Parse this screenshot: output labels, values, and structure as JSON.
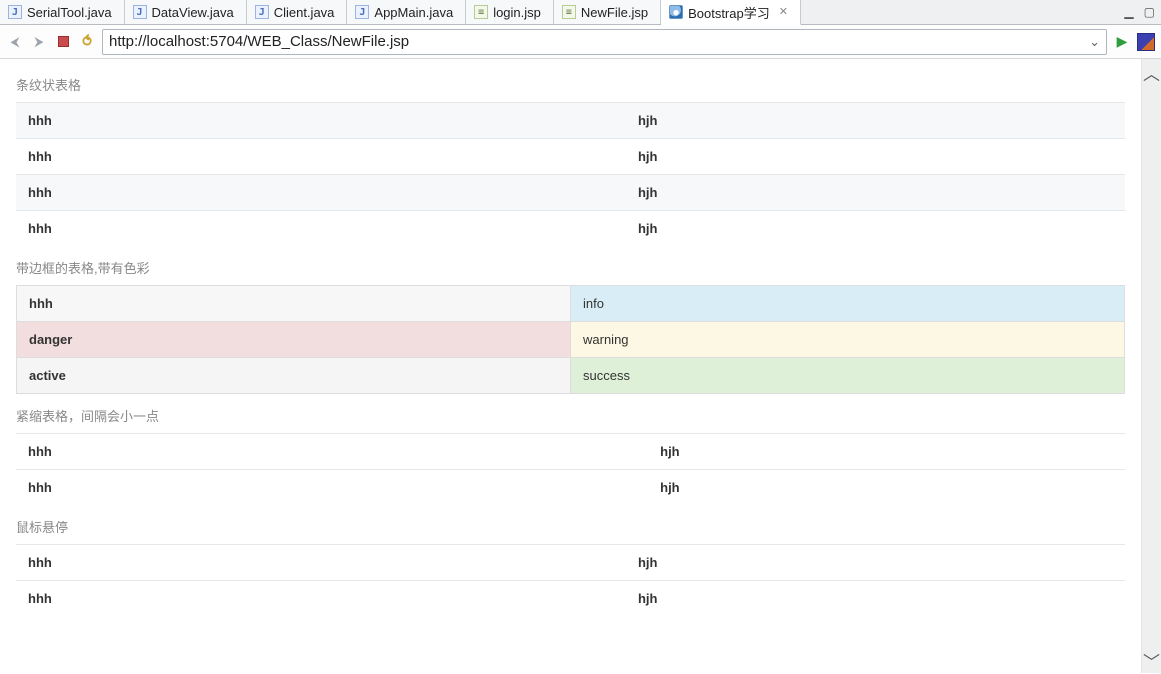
{
  "tabs": [
    {
      "label": "SerialTool.java",
      "icon": "j"
    },
    {
      "label": "DataView.java",
      "icon": "j"
    },
    {
      "label": "Client.java",
      "icon": "j"
    },
    {
      "label": "AppMain.java",
      "icon": "j"
    },
    {
      "label": "login.jsp",
      "icon": "jsp"
    },
    {
      "label": "NewFile.jsp",
      "icon": "jsp"
    },
    {
      "label": "Bootstrap学习",
      "icon": "web",
      "active": true,
      "closable": true
    }
  ],
  "url": "http://localhost:5704/WEB_Class/NewFile.jsp",
  "sections": {
    "striped": {
      "title": "条纹状表格",
      "rows": [
        {
          "c1": "hhh",
          "c2": "hjh"
        },
        {
          "c1": "hhh",
          "c2": "hjh"
        },
        {
          "c1": "hhh",
          "c2": "hjh"
        },
        {
          "c1": "hhh",
          "c2": "hjh"
        }
      ]
    },
    "bordered": {
      "title": "带边框的表格,带有色彩",
      "rows": [
        {
          "c1": "hhh",
          "c1_class": "cell-bold",
          "c2": "info",
          "c2_class": "cell-info"
        },
        {
          "c1": "danger",
          "c1_class": "cell-danger",
          "c2": "warning",
          "c2_class": "cell-warning"
        },
        {
          "c1": "active",
          "c1_class": "cell-active",
          "c2": "success",
          "c2_class": "cell-success"
        }
      ]
    },
    "condensed": {
      "title": "紧缩表格，间隔会小一点",
      "rows": [
        {
          "c1": "hhh",
          "c2": "hjh"
        },
        {
          "c1": "hhh",
          "c2": "hjh"
        }
      ]
    },
    "hover": {
      "title": "鼠标悬停",
      "rows": [
        {
          "c1": "hhh",
          "c2": "hjh"
        },
        {
          "c1": "hhh",
          "c2": "hjh"
        }
      ]
    }
  }
}
